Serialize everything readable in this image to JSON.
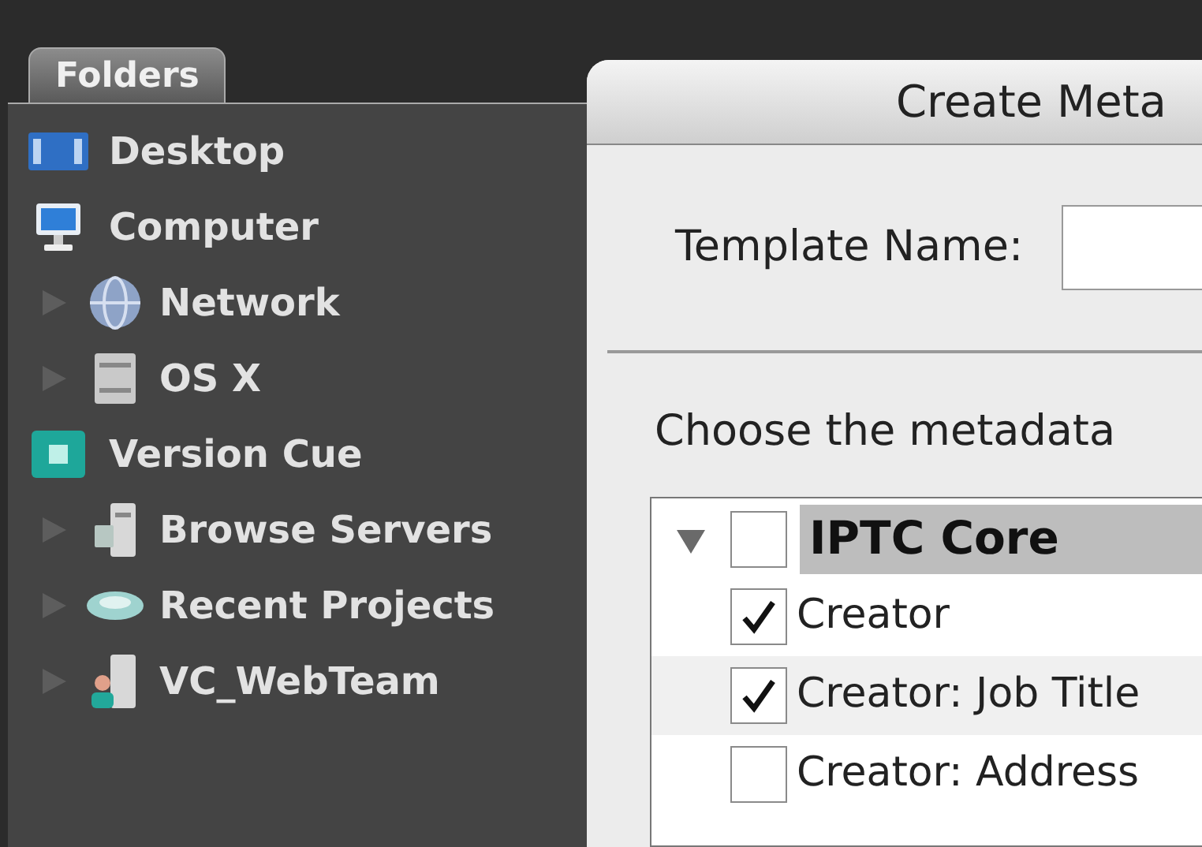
{
  "panel": {
    "tab": "Folders",
    "tree": [
      {
        "label": "Desktop",
        "kind": "desktop"
      },
      {
        "label": "Computer",
        "kind": "computer",
        "children": [
          {
            "label": "Network",
            "kind": "network",
            "expanded": false
          },
          {
            "label": "OS X",
            "kind": "volume",
            "expanded": false
          }
        ]
      },
      {
        "label": "Version Cue",
        "kind": "versioncue",
        "children": [
          {
            "label": "Browse Servers",
            "kind": "servers",
            "expanded": false
          },
          {
            "label": "Recent Projects",
            "kind": "projects",
            "expanded": false
          },
          {
            "label": "VC_WebTeam",
            "kind": "team",
            "expanded": false
          }
        ]
      }
    ]
  },
  "dialog": {
    "title": "Create Meta",
    "template_label": "Template Name:",
    "instruction": "Choose the metadata",
    "group": {
      "label": "IPTC Core",
      "expanded": true,
      "checked": false,
      "items": [
        {
          "label": "Creator",
          "checked": true
        },
        {
          "label": "Creator: Job Title",
          "checked": true
        },
        {
          "label": "Creator: Address",
          "checked": false
        }
      ]
    }
  }
}
